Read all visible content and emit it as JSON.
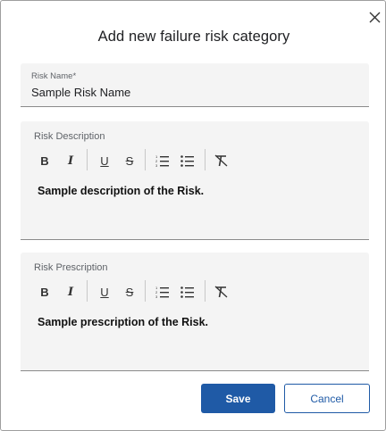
{
  "dialog": {
    "title": "Add new failure risk category",
    "close_icon": "close-icon"
  },
  "risk_name": {
    "label": "Risk Name*",
    "value": "Sample Risk Name"
  },
  "description": {
    "label": "Risk Description",
    "content": "Sample description of the Risk."
  },
  "prescription": {
    "label": "Risk Prescription",
    "content": "Sample prescription of the Risk."
  },
  "toolbar": {
    "buttons": [
      "bold-icon",
      "italic-icon",
      "underline-icon",
      "strikethrough-icon",
      "ordered-list-icon",
      "bullet-list-icon",
      "clear-format-icon"
    ],
    "bold_glyph": "B",
    "italic_glyph": "I",
    "underline_glyph": "U",
    "strike_glyph": "S"
  },
  "actions": {
    "save_label": "Save",
    "cancel_label": "Cancel"
  },
  "colors": {
    "primary": "#1f5aa6",
    "field_bg": "#f4f4f4"
  }
}
